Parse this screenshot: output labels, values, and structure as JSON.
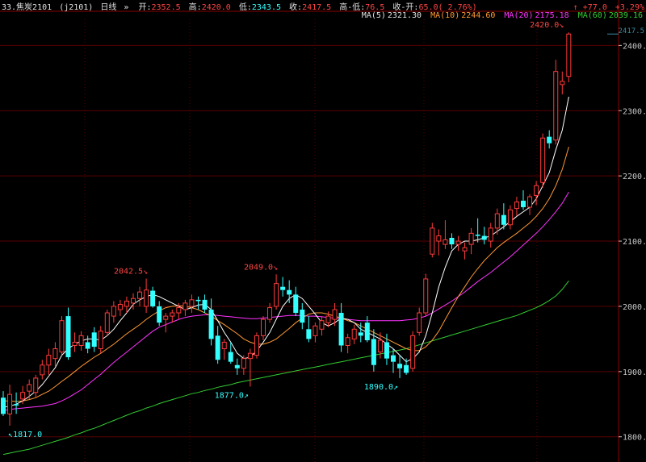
{
  "header": {
    "symbol": "33.焦炭2101",
    "code": "(j2101)",
    "period": "日线",
    "open_label": "开:",
    "open": "2352.5",
    "high_label": "高:",
    "high": "2420.0",
    "low_label": "低:",
    "low": "2343.5",
    "close_label": "收:",
    "close": "2417.5",
    "range_label": "高-低:",
    "range": "76.5",
    "change_label": "收-开:",
    "change": "65.0( 2.76%)",
    "top_change": "+77.0",
    "top_pct": "+3.29%"
  },
  "ma_legend": [
    {
      "label": "MA(5)",
      "value": "2321.30",
      "color": "#ffffff"
    },
    {
      "label": "MA(10)",
      "value": "2244.60",
      "color": "#ff9933"
    },
    {
      "label": "MA(20)",
      "value": "2175.18",
      "color": "#ff33ff"
    },
    {
      "label": "MA(60)",
      "value": "2039.16",
      "color": "#33cc33"
    }
  ],
  "price_marker": "2417.5",
  "annotations": [
    {
      "text": "2042.5",
      "arrow": "↘",
      "index": 22,
      "price": 2042.5,
      "color": "#ff4444",
      "side": "up"
    },
    {
      "text": "2049.0",
      "arrow": "↘",
      "index": 42,
      "price": 2049.0,
      "color": "#ff4444",
      "side": "up"
    },
    {
      "text": "2420.0",
      "arrow": "↘",
      "index": 86,
      "price": 2420.0,
      "color": "#ff4444",
      "side": "up"
    },
    {
      "text": "1817.0",
      "arrow": "↖",
      "index": 1,
      "price": 1817.0,
      "color": "#33ffff",
      "side": "down"
    },
    {
      "text": "1877.0",
      "arrow": "↗",
      "index": 38,
      "price": 1877.0,
      "color": "#33ffff",
      "side": "down"
    },
    {
      "text": "1890.0",
      "arrow": "↗",
      "index": 61,
      "price": 1890.0,
      "color": "#33ffff",
      "side": "down"
    }
  ],
  "chart_data": {
    "type": "candlestick",
    "title": "焦炭2101 日线",
    "ylim": [
      1770,
      2440
    ],
    "yticks": [
      1800,
      1900,
      2000,
      2100,
      2200,
      2300,
      2400
    ],
    "ytick_labels": [
      "1800.0",
      "1900.0",
      "2000.0",
      "2100.0",
      "2200.0",
      "2300.0",
      "2400.0"
    ],
    "grid": true,
    "colors": {
      "up": "#ff3b3b",
      "down": "#33ffff",
      "grid": "#5a0000",
      "ma5": "#ffffff",
      "ma10": "#ff9933",
      "ma20": "#ff33ff",
      "ma60": "#33cc33"
    },
    "candles": [
      [
        1860,
        1870,
        1832,
        1835
      ],
      [
        1835,
        1880,
        1817,
        1865
      ],
      [
        1850,
        1868,
        1835,
        1848
      ],
      [
        1858,
        1878,
        1850,
        1868
      ],
      [
        1870,
        1888,
        1858,
        1880
      ],
      [
        1868,
        1895,
        1860,
        1890
      ],
      [
        1895,
        1918,
        1888,
        1910
      ],
      [
        1910,
        1935,
        1895,
        1925
      ],
      [
        1920,
        1945,
        1908,
        1935
      ],
      [
        1930,
        1985,
        1925,
        1978
      ],
      [
        1985,
        1998,
        1918,
        1922
      ],
      [
        1940,
        1960,
        1930,
        1945
      ],
      [
        1940,
        1962,
        1932,
        1955
      ],
      [
        1945,
        1955,
        1928,
        1935
      ],
      [
        1960,
        1968,
        1930,
        1938
      ],
      [
        1935,
        1970,
        1928,
        1962
      ],
      [
        1960,
        1995,
        1955,
        1990
      ],
      [
        1985,
        2008,
        1975,
        2000
      ],
      [
        1995,
        2010,
        1985,
        2003
      ],
      [
        2000,
        2015,
        1990,
        2008
      ],
      [
        2005,
        2020,
        1995,
        2012
      ],
      [
        2012,
        2030,
        2000,
        2022
      ],
      [
        2000,
        2042.5,
        1990,
        2025
      ],
      [
        2024,
        2030,
        1998,
        2000
      ],
      [
        2000,
        2008,
        1970,
        1975
      ],
      [
        1980,
        1990,
        1960,
        1985
      ],
      [
        1985,
        1995,
        1975,
        1990
      ],
      [
        1990,
        2005,
        1980,
        1998
      ],
      [
        1995,
        2010,
        1985,
        2005
      ],
      [
        2000,
        2018,
        1990,
        2010
      ],
      [
        2010,
        2015,
        1995,
        2008
      ],
      [
        2010,
        2018,
        1990,
        1995
      ],
      [
        1995,
        2012,
        1940,
        1950
      ],
      [
        1955,
        1970,
        1912,
        1918
      ],
      [
        1935,
        1950,
        1918,
        1945
      ],
      [
        1930,
        1945,
        1912,
        1915
      ],
      [
        1910,
        1920,
        1895,
        1905
      ],
      [
        1905,
        1925,
        1895,
        1920
      ],
      [
        1920,
        1935,
        1877,
        1928
      ],
      [
        1925,
        1960,
        1920,
        1955
      ],
      [
        1955,
        1985,
        1948,
        1980
      ],
      [
        1980,
        2005,
        1975,
        1998
      ],
      [
        2000,
        2049,
        1995,
        2035
      ],
      [
        2030,
        2045,
        2015,
        2025
      ],
      [
        2025,
        2040,
        2005,
        2018
      ],
      [
        2018,
        2030,
        1985,
        1990
      ],
      [
        1995,
        2005,
        1965,
        1975
      ],
      [
        1965,
        1985,
        1945,
        1950
      ],
      [
        1955,
        1975,
        1945,
        1970
      ],
      [
        1965,
        1985,
        1955,
        1978
      ],
      [
        1975,
        1992,
        1968,
        1985
      ],
      [
        1980,
        2005,
        1970,
        1995
      ],
      [
        1990,
        2005,
        1930,
        1940
      ],
      [
        1940,
        1958,
        1928,
        1952
      ],
      [
        1950,
        1972,
        1942,
        1965
      ],
      [
        1960,
        1975,
        1945,
        1955
      ],
      [
        1975,
        1985,
        1945,
        1948
      ],
      [
        1950,
        1965,
        1900,
        1910
      ],
      [
        1930,
        1960,
        1920,
        1948
      ],
      [
        1945,
        1958,
        1910,
        1920
      ],
      [
        1925,
        1935,
        1898,
        1915
      ],
      [
        1912,
        1925,
        1890,
        1905
      ],
      [
        1910,
        1920,
        1895,
        1898
      ],
      [
        1905,
        1962,
        1900,
        1955
      ],
      [
        1960,
        1998,
        1955,
        1990
      ],
      [
        1990,
        2050,
        1985,
        2042
      ],
      [
        2080,
        2128,
        2075,
        2120
      ],
      [
        2100,
        2118,
        2078,
        2108
      ],
      [
        2095,
        2132,
        2088,
        2102
      ],
      [
        2105,
        2112,
        2088,
        2095
      ],
      [
        2095,
        2108,
        2085,
        2100
      ],
      [
        2085,
        2098,
        2072,
        2090
      ],
      [
        2095,
        2120,
        2080,
        2112
      ],
      [
        2110,
        2135,
        2098,
        2108
      ],
      [
        2108,
        2122,
        2095,
        2102
      ],
      [
        2100,
        2128,
        2090,
        2120
      ],
      [
        2120,
        2150,
        2110,
        2142
      ],
      [
        2140,
        2158,
        2118,
        2125
      ],
      [
        2125,
        2155,
        2118,
        2148
      ],
      [
        2150,
        2168,
        2138,
        2160
      ],
      [
        2162,
        2178,
        2148,
        2152
      ],
      [
        2152,
        2172,
        2140,
        2168
      ],
      [
        2170,
        2192,
        2155,
        2185
      ],
      [
        2190,
        2265,
        2182,
        2258
      ],
      [
        2260,
        2270,
        2242,
        2250
      ],
      [
        2255,
        2378,
        2248,
        2360
      ],
      [
        2340,
        2360,
        2325,
        2345
      ],
      [
        2352.5,
        2420,
        2343.5,
        2417.5
      ]
    ],
    "ma5": [
      1845,
      1847,
      1850,
      1855,
      1862,
      1870,
      1880,
      1893,
      1906,
      1925,
      1935,
      1942,
      1947,
      1950,
      1950,
      1948,
      1955,
      1965,
      1978,
      1990,
      2003,
      2010,
      2015,
      2018,
      2015,
      2010,
      2005,
      2000,
      1995,
      1998,
      2002,
      2003,
      1995,
      1978,
      1960,
      1945,
      1928,
      1920,
      1922,
      1932,
      1945,
      1960,
      1980,
      2000,
      2012,
      2018,
      2012,
      2000,
      1988,
      1975,
      1970,
      1975,
      1982,
      1980,
      1975,
      1965,
      1960,
      1955,
      1950,
      1942,
      1935,
      1925,
      1915,
      1920,
      1930,
      1955,
      1990,
      2030,
      2060,
      2085,
      2095,
      2100,
      2100,
      2102,
      2105,
      2108,
      2115,
      2122,
      2130,
      2138,
      2145,
      2152,
      2165,
      2185,
      2205,
      2240,
      2270,
      2321.3
    ],
    "ma10": [
      1855,
      1855,
      1854,
      1855,
      1857,
      1860,
      1865,
      1870,
      1877,
      1885,
      1892,
      1900,
      1908,
      1915,
      1922,
      1928,
      1935,
      1942,
      1950,
      1958,
      1965,
      1972,
      1980,
      1987,
      1993,
      1998,
      2000,
      2001,
      2000,
      1998,
      1995,
      1990,
      1985,
      1978,
      1972,
      1965,
      1958,
      1950,
      1945,
      1942,
      1942,
      1945,
      1950,
      1958,
      1966,
      1975,
      1982,
      1988,
      1990,
      1990,
      1988,
      1985,
      1982,
      1978,
      1975,
      1970,
      1965,
      1960,
      1955,
      1950,
      1945,
      1940,
      1935,
      1932,
      1932,
      1938,
      1948,
      1962,
      1980,
      1998,
      2015,
      2030,
      2045,
      2058,
      2070,
      2080,
      2090,
      2098,
      2105,
      2112,
      2120,
      2128,
      2138,
      2150,
      2165,
      2185,
      2210,
      2244.6
    ],
    "ma20": [
      1840,
      1842,
      1843,
      1844,
      1845,
      1846,
      1847,
      1849,
      1851,
      1855,
      1860,
      1866,
      1872,
      1880,
      1888,
      1896,
      1905,
      1914,
      1922,
      1930,
      1938,
      1946,
      1954,
      1962,
      1968,
      1972,
      1976,
      1980,
      1983,
      1985,
      1986,
      1987,
      1987,
      1986,
      1985,
      1984,
      1983,
      1982,
      1981,
      1981,
      1982,
      1983,
      1984,
      1985,
      1986,
      1986,
      1986,
      1985,
      1985,
      1984,
      1983,
      1982,
      1981,
      1980,
      1979,
      1978,
      1978,
      1978,
      1978,
      1978,
      1978,
      1978,
      1979,
      1980,
      1982,
      1985,
      1990,
      1996,
      2002,
      2008,
      2015,
      2022,
      2030,
      2038,
      2045,
      2052,
      2060,
      2068,
      2076,
      2085,
      2094,
      2103,
      2112,
      2122,
      2133,
      2145,
      2158,
      2175.18
    ],
    "ma60": [
      1773,
      1775,
      1777,
      1779,
      1781,
      1784,
      1787,
      1790,
      1793,
      1796,
      1799,
      1803,
      1806,
      1810,
      1813,
      1817,
      1821,
      1825,
      1829,
      1833,
      1837,
      1840,
      1844,
      1847,
      1851,
      1854,
      1857,
      1860,
      1863,
      1866,
      1868,
      1871,
      1873,
      1876,
      1878,
      1880,
      1883,
      1885,
      1887,
      1889,
      1891,
      1893,
      1895,
      1897,
      1899,
      1901,
      1903,
      1905,
      1907,
      1909,
      1911,
      1913,
      1915,
      1917,
      1919,
      1921,
      1923,
      1925,
      1927,
      1929,
      1931,
      1933,
      1935,
      1938,
      1941,
      1944,
      1947,
      1950,
      1953,
      1956,
      1959,
      1962,
      1965,
      1968,
      1971,
      1974,
      1977,
      1980,
      1983,
      1986,
      1990,
      1994,
      1998,
      2003,
      2009,
      2016,
      2026,
      2039.16
    ]
  }
}
